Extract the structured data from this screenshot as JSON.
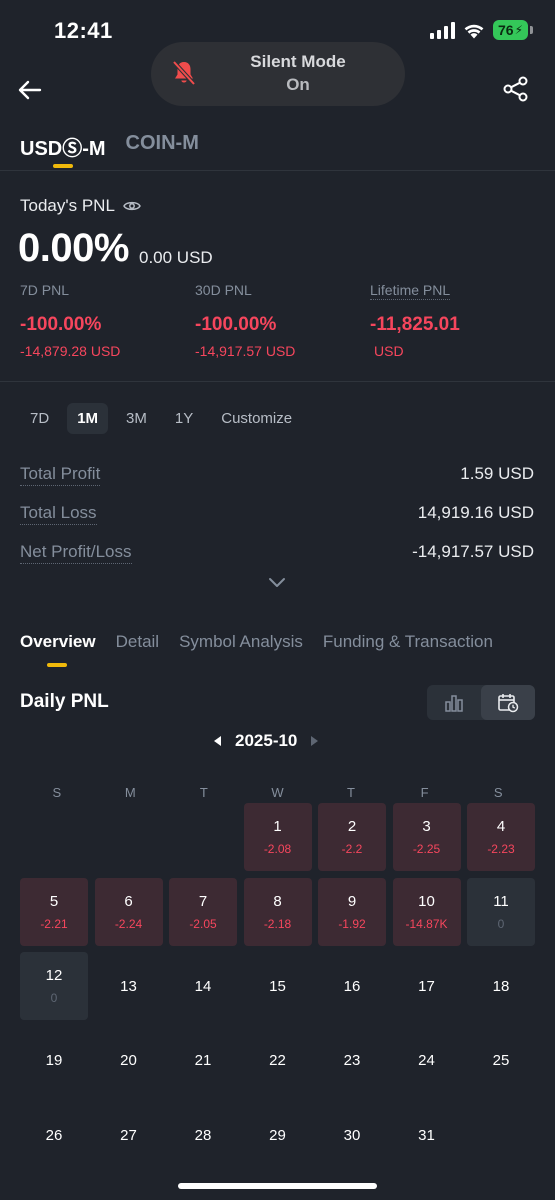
{
  "status_bar": {
    "time": "12:41",
    "battery": "76"
  },
  "silent_notice": {
    "title": "Silent Mode",
    "status": "On"
  },
  "top_tabs": [
    "USDⓈ-M",
    "COIN-M"
  ],
  "today": {
    "label": "Today's PNL",
    "pct": "0.00%",
    "usd": "0.00 USD"
  },
  "stats": [
    {
      "label": "7D PNL",
      "pct": "-100.00%",
      "usd": "-14,879.28 USD"
    },
    {
      "label": "30D PNL",
      "pct": "-100.00%",
      "usd": "-14,917.57 USD"
    },
    {
      "label": "Lifetime PNL",
      "pct": "-11,825.01",
      "usd": "USD"
    }
  ],
  "range_tabs": [
    "7D",
    "1M",
    "3M",
    "1Y",
    "Customize"
  ],
  "range_active": "1M",
  "summary": [
    {
      "label": "Total Profit",
      "value": "1.59 USD"
    },
    {
      "label": "Total Loss",
      "value": "14,919.16 USD"
    },
    {
      "label": "Net Profit/Loss",
      "value": "-14,917.57 USD"
    }
  ],
  "section_tabs": [
    "Overview",
    "Detail",
    "Symbol Analysis",
    "Funding & Transaction"
  ],
  "daily": {
    "title": "Daily PNL",
    "month": "2025-10",
    "weekdays": [
      "S",
      "M",
      "T",
      "W",
      "T",
      "F",
      "S"
    ],
    "days": [
      {
        "day": "1",
        "value": "-2.08"
      },
      {
        "day": "2",
        "value": "-2.2"
      },
      {
        "day": "3",
        "value": "-2.25"
      },
      {
        "day": "4",
        "value": "-2.23"
      },
      {
        "day": "5",
        "value": "-2.21"
      },
      {
        "day": "6",
        "value": "-2.24"
      },
      {
        "day": "7",
        "value": "-2.05"
      },
      {
        "day": "8",
        "value": "-2.18"
      },
      {
        "day": "9",
        "value": "-1.92"
      },
      {
        "day": "10",
        "value": "-14.87K"
      },
      {
        "day": "11",
        "value": "0"
      },
      {
        "day": "12",
        "value": "0"
      },
      {
        "day": "13"
      },
      {
        "day": "14"
      },
      {
        "day": "15"
      },
      {
        "day": "16"
      },
      {
        "day": "17"
      },
      {
        "day": "18"
      },
      {
        "day": "19"
      },
      {
        "day": "20"
      },
      {
        "day": "21"
      },
      {
        "day": "22"
      },
      {
        "day": "23"
      },
      {
        "day": "24"
      },
      {
        "day": "25"
      },
      {
        "day": "26"
      },
      {
        "day": "27"
      },
      {
        "day": "28"
      },
      {
        "day": "29"
      },
      {
        "day": "30"
      },
      {
        "day": "31"
      }
    ]
  },
  "colors": {
    "background": "#1f232b",
    "accent": "#f0b90b",
    "loss": "#f6465d",
    "loss_cell": "#3d2a33",
    "neutral_cell": "#2b3139"
  }
}
